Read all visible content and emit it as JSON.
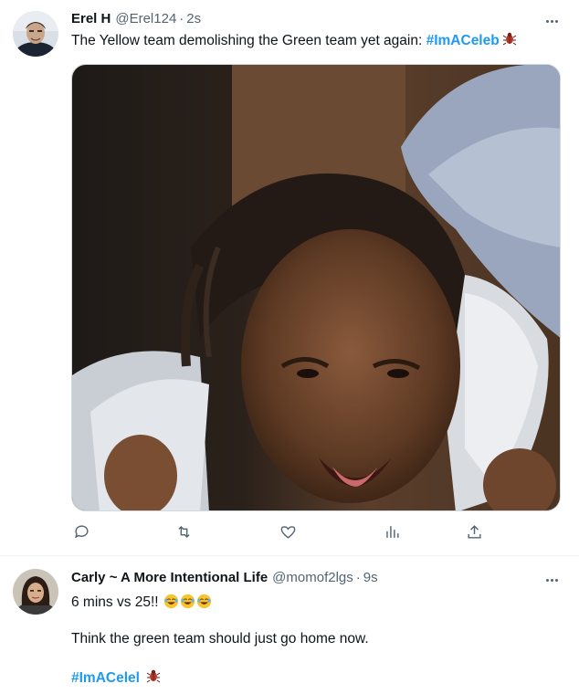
{
  "tweets": [
    {
      "name": "Erel H",
      "handle": "@Erel124",
      "dot": "·",
      "time": "2s",
      "text": "The Yellow team demolishing the Green team yet again: ",
      "hashtag": "#ImACeleb",
      "media": "gif-image",
      "actions": [
        "reply-icon",
        "retweet-icon",
        "like-icon",
        "views-icon",
        "share-icon"
      ]
    },
    {
      "name": "Carly ~ A More Intentional Life",
      "handle": "@momof2lgs",
      "dot": "·",
      "time": "9s",
      "line1": "6 mins vs 25!!",
      "line2": "Think the green team should just go home now.",
      "hashtag": "#ImACelel"
    }
  ],
  "colors": {
    "accent": "#1d9bf0",
    "muted": "#536471",
    "text": "#0f1419"
  }
}
